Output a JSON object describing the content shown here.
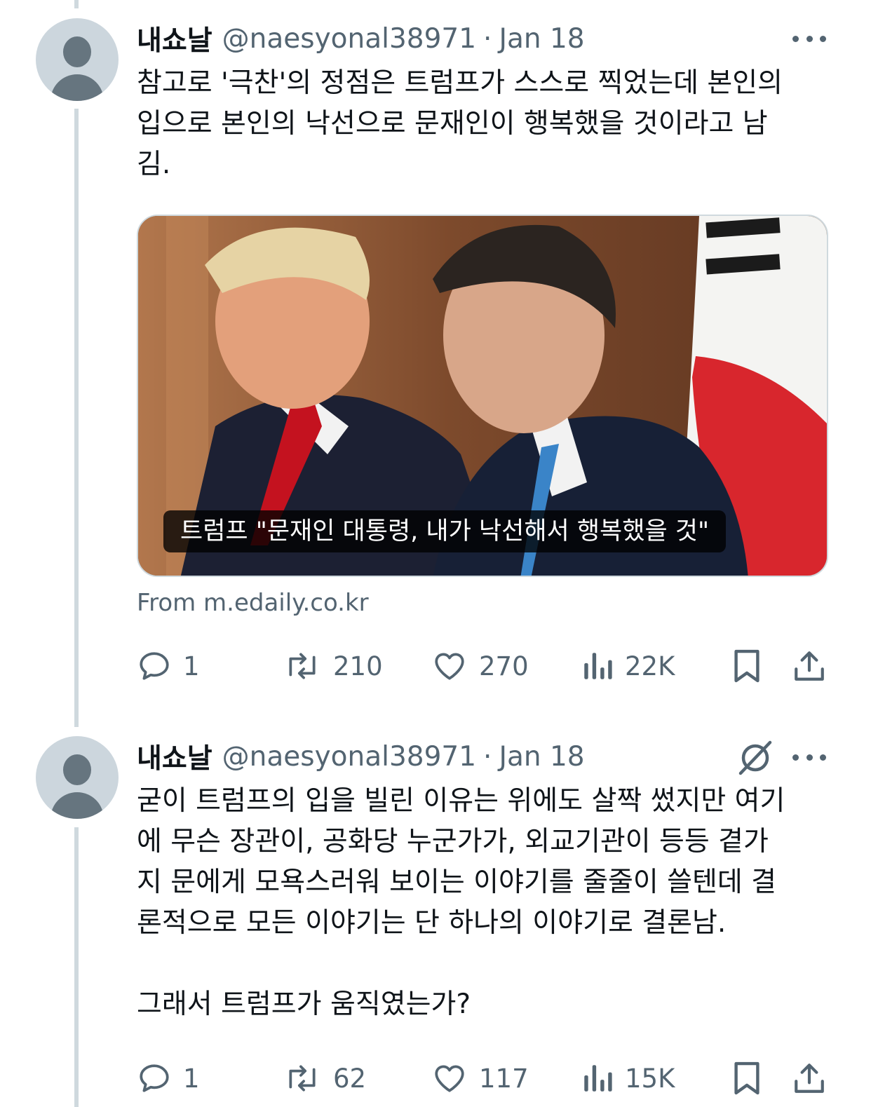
{
  "tweets": [
    {
      "display_name": "내쇼날",
      "handle": "@naesyonal38971",
      "separator": "·",
      "date": "Jan 18",
      "text": "참고로 '극찬'의 정점은 트럼프가 스스로 찍었는데 본인의\n입으로 본인의 낙선으로 문재인이 행복했을 것이라고 남\n김.",
      "media_caption": "트럼프 \"문재인 대통령, 내가 낙선해서 행복했을 것\"",
      "source": "From m.edaily.co.kr",
      "stats": {
        "replies": "1",
        "reposts": "210",
        "likes": "270",
        "views": "22K"
      }
    },
    {
      "display_name": "내쇼날",
      "handle": "@naesyonal38971",
      "separator": "·",
      "date": "Jan 18",
      "text": "굳이 트럼프의 입을 빌린 이유는 위에도 살짝 썼지만 여기\n에 무슨 장관이, 공화당 누군가가, 외교기관이 등등 곁가\n지 문에게 모욕스러워 보이는 이야기를 줄줄이 쓸텐데 결\n론적으로 모든 이야기는 단 하나의 이야기로 결론남.\n\n그래서 트럼프가 움직였는가?",
      "stats": {
        "replies": "1",
        "reposts": "62",
        "likes": "117",
        "views": "15K"
      }
    }
  ],
  "icons": {
    "more": "more-dots-icon",
    "grok": "grok-icon",
    "reply": "reply-bubble-icon",
    "repost": "repost-arrows-icon",
    "like": "heart-icon",
    "views": "bar-chart-icon",
    "bookmark": "bookmark-icon",
    "share": "share-upload-icon"
  },
  "colors": {
    "text": "#0f1419",
    "secondary": "#536471",
    "thread_line": "#cfd9de",
    "avatar_bg": "#ccd6dd"
  }
}
